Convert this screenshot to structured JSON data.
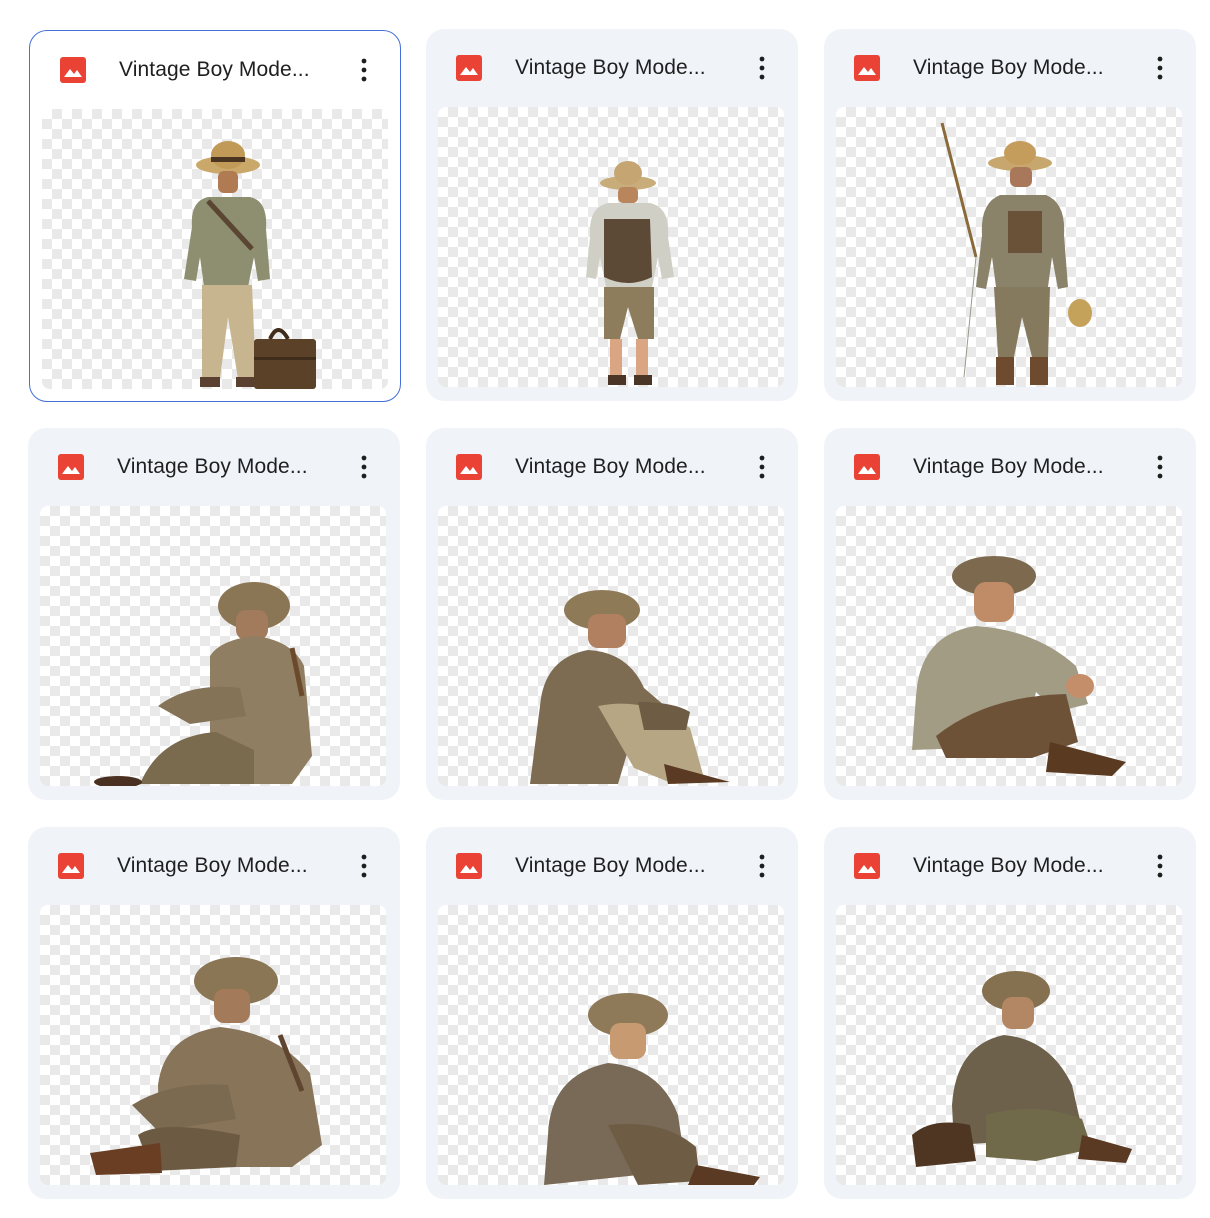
{
  "files": [
    {
      "name": "Vintage Boy Mode...",
      "icon": "image-file-icon",
      "selected": true
    },
    {
      "name": "Vintage Boy Mode...",
      "icon": "image-file-icon"
    },
    {
      "name": "Vintage Boy Mode...",
      "icon": "image-file-icon"
    },
    {
      "name": "Vintage Boy Mode...",
      "icon": "image-file-icon"
    },
    {
      "name": "Vintage Boy Mode...",
      "icon": "image-file-icon"
    },
    {
      "name": "Vintage Boy Mode...",
      "icon": "image-file-icon"
    },
    {
      "name": "Vintage Boy Mode...",
      "icon": "image-file-icon"
    },
    {
      "name": "Vintage Boy Mode...",
      "icon": "image-file-icon"
    },
    {
      "name": "Vintage Boy Mode...",
      "icon": "image-file-icon"
    }
  ],
  "colors": {
    "icon_red": "#ea4335",
    "selection_border": "#4470d8",
    "card_bg": "#f0f4f9"
  }
}
